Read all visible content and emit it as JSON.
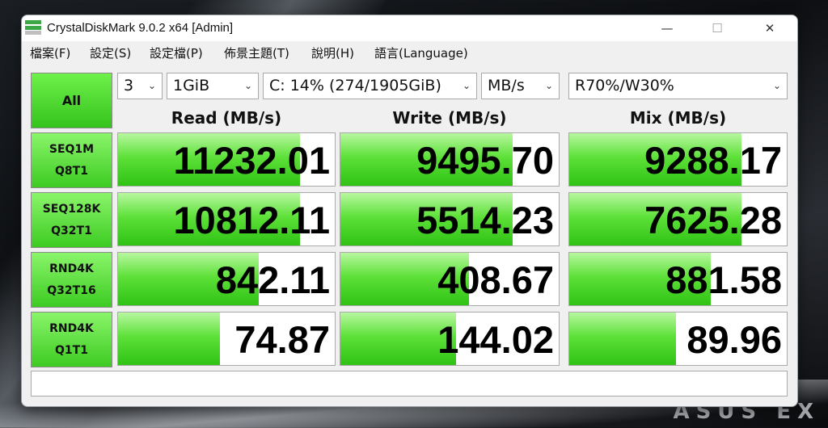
{
  "background": {
    "brand_text": "ASUS EX"
  },
  "window": {
    "title": "CrystalDiskMark 9.0.2 x64 [Admin]",
    "controls": {
      "minimize": "—",
      "maximize": "☐",
      "close": "✕"
    }
  },
  "menu": [
    {
      "label": "檔案(F)"
    },
    {
      "label": "設定(S)"
    },
    {
      "label": "設定檔(P)"
    },
    {
      "label": "佈景主題(T)"
    },
    {
      "label": "說明(H)"
    },
    {
      "label": "語言(Language)"
    }
  ],
  "toolbar": {
    "all_button": "All",
    "count": "3",
    "size": "1GiB",
    "drive": "C: 14% (274/1905GiB)",
    "unit": "MB/s",
    "mix": "R70%/W30%"
  },
  "headers": {
    "read": "Read (MB/s)",
    "write": "Write (MB/s)",
    "mix": "Mix (MB/s)"
  },
  "rows": [
    {
      "label_line1": "SEQ1M",
      "label_line2": "Q8T1",
      "read": "11232.01",
      "write": "9495.70",
      "mix": "9288.17",
      "read_fill": 0.84,
      "write_fill": 0.79,
      "mix_fill": 0.79
    },
    {
      "label_line1": "SEQ128K",
      "label_line2": "Q32T1",
      "read": "10812.11",
      "write": "5514.23",
      "mix": "7625.28",
      "read_fill": 0.84,
      "write_fill": 0.79,
      "mix_fill": 0.79
    },
    {
      "label_line1": "RND4K",
      "label_line2": "Q32T16",
      "read": "842.11",
      "write": "408.67",
      "mix": "881.58",
      "read_fill": 0.65,
      "write_fill": 0.59,
      "mix_fill": 0.65
    },
    {
      "label_line1": "RND4K",
      "label_line2": "Q1T1",
      "read": "74.87",
      "write": "144.02",
      "mix": "89.96",
      "read_fill": 0.47,
      "write_fill": 0.53,
      "mix_fill": 0.49
    }
  ],
  "status_text": "",
  "colors": {
    "accent_green": "#35c41c",
    "fill_light": "#b8f7a0"
  }
}
